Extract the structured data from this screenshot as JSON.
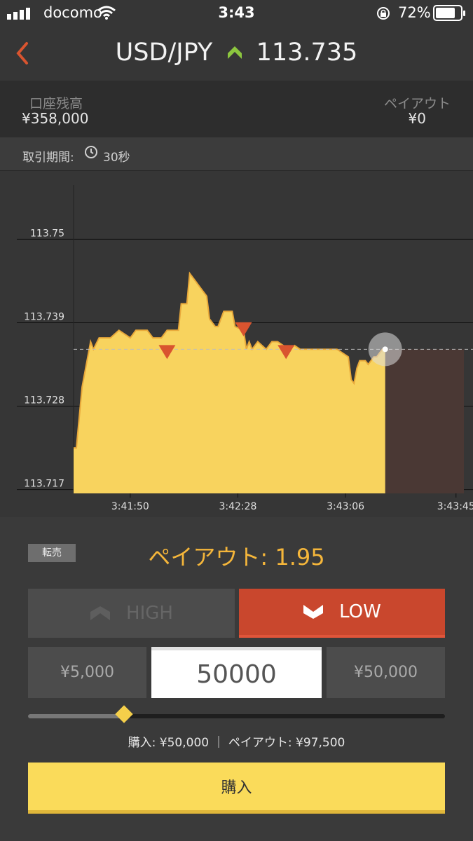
{
  "status_bar": {
    "carrier": "docomo",
    "time": "3:43",
    "battery": "72%"
  },
  "header": {
    "pair": "USD/JPY",
    "price": "113.735",
    "trend_icon": "up-chevron-icon",
    "trend_color": "#8cc63f"
  },
  "account": {
    "balance_label": "口座残高",
    "balance_value": "¥358,000",
    "payout_label": "ペイアウト",
    "payout_value": "¥0"
  },
  "period": {
    "label": "取引期間:",
    "value": "30秒",
    "icon": "clock-icon"
  },
  "chart_data": {
    "type": "area",
    "y_ticks": [
      "113.75",
      "113.739",
      "113.728",
      "113.717"
    ],
    "x_ticks": [
      "3:41:50",
      "3:42:28",
      "3:43:06",
      "3:43:45"
    ],
    "ylim": [
      113.7165,
      113.759
    ],
    "x_range": [
      "3:41:30",
      "3:43:51"
    ],
    "current_time": "3:43:20",
    "current_rate": 113.7355,
    "fill_color": "#f8d35e",
    "line_color": "#e8a83a",
    "expiry_zone_color": "#4a3834",
    "series": [
      {
        "values": [
          [
            "3:41:30",
            113.7225
          ],
          [
            "3:41:31",
            113.7225
          ],
          [
            "3:41:33",
            113.7305
          ],
          [
            "3:41:36",
            113.7365
          ],
          [
            "3:41:37",
            113.7355
          ],
          [
            "3:41:39",
            113.737
          ],
          [
            "3:41:41",
            113.737
          ],
          [
            "3:41:43",
            113.737
          ],
          [
            "3:41:46",
            113.738
          ],
          [
            "3:41:48",
            113.7375
          ],
          [
            "3:41:50",
            113.737
          ],
          [
            "3:41:52",
            113.738
          ],
          [
            "3:41:56",
            113.738
          ],
          [
            "3:41:58",
            113.737
          ],
          [
            "3:42:01",
            113.737
          ],
          [
            "3:42:03",
            113.738
          ],
          [
            "3:42:06",
            113.738
          ],
          [
            "3:42:07",
            113.738
          ],
          [
            "3:42:08",
            113.7415
          ],
          [
            "3:42:10",
            113.7415
          ],
          [
            "3:42:11",
            113.7455
          ],
          [
            "3:42:13",
            113.7445
          ],
          [
            "3:42:15",
            113.7435
          ],
          [
            "3:42:17",
            113.7425
          ],
          [
            "3:42:18",
            113.7395
          ],
          [
            "3:42:20",
            113.7385
          ],
          [
            "3:42:21",
            113.7385
          ],
          [
            "3:42:22",
            113.7395
          ],
          [
            "3:42:23",
            113.7405
          ],
          [
            "3:42:26",
            113.7405
          ],
          [
            "3:42:27",
            113.7385
          ],
          [
            "3:42:30",
            113.738
          ],
          [
            "3:42:31",
            113.7355
          ],
          [
            "3:42:32",
            113.7365
          ],
          [
            "3:42:33",
            113.7355
          ],
          [
            "3:42:35",
            113.7365
          ],
          [
            "3:42:38",
            113.7355
          ],
          [
            "3:42:40",
            113.7365
          ],
          [
            "3:42:42",
            113.7365
          ],
          [
            "3:42:46",
            113.7355
          ],
          [
            "3:42:48",
            113.736
          ],
          [
            "3:42:50",
            113.7355
          ],
          [
            "3:43:03",
            113.7355
          ],
          [
            "3:43:05",
            113.735
          ],
          [
            "3:43:07",
            113.7345
          ],
          [
            "3:43:08",
            113.7315
          ],
          [
            "3:43:09",
            113.731
          ],
          [
            "3:43:10",
            113.733
          ],
          [
            "3:43:11",
            113.734
          ],
          [
            "3:43:13",
            113.734
          ],
          [
            "3:43:14",
            113.7335
          ],
          [
            "3:43:15",
            113.734
          ],
          [
            "3:43:16",
            113.7345
          ],
          [
            "3:43:17",
            113.7345
          ],
          [
            "3:43:18",
            113.735
          ],
          [
            "3:43:19",
            113.7355
          ],
          [
            "3:43:20",
            113.7355
          ]
        ]
      }
    ],
    "trade_markers": [
      {
        "type": "sell",
        "time": "3:42:03",
        "rate": 113.7355
      },
      {
        "type": "sell",
        "time": "3:42:30",
        "rate": 113.7385
      },
      {
        "type": "sell",
        "time": "3:42:45",
        "rate": 113.7355
      }
    ]
  },
  "panel": {
    "resell_label": "転売",
    "payout_rate": "ペイアウト: 1.95",
    "high_label": "HIGH",
    "low_label": "LOW",
    "amount_min": "¥5,000",
    "amount_value": "50000",
    "amount_max": "¥50,000",
    "slider_level": 0.23,
    "summary": "購入: ¥50,000 ｜ ペイアウト: ¥97,500",
    "buy_label": "購入",
    "accent_yellow": "#fadb5a",
    "low_red": "#c9472d"
  }
}
